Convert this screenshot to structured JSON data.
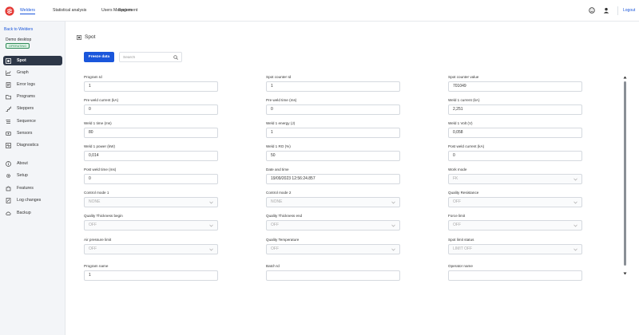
{
  "topbar": {
    "tabs": [
      {
        "label": "Welders",
        "active": true
      },
      {
        "label": "Statistical analysis",
        "active": false
      },
      {
        "label": "Users Management",
        "active": false
      },
      {
        "label": "System",
        "active": false
      }
    ],
    "logout_label": "Logout"
  },
  "sidebar": {
    "back_label": "Back to Welders",
    "device_name": "Demo desktop",
    "status_badge": "OPERATING",
    "items": [
      {
        "label": "Spot",
        "icon": "spot-icon",
        "active": true
      },
      {
        "label": "Graph",
        "icon": "graph-icon"
      },
      {
        "label": "Error logs",
        "icon": "error-logs-icon"
      },
      {
        "label": "Programs",
        "icon": "folder-icon"
      },
      {
        "label": "Steppers",
        "icon": "steppers-icon"
      },
      {
        "label": "Sequence",
        "icon": "sequence-icon"
      },
      {
        "label": "Sensors",
        "icon": "sensors-icon"
      },
      {
        "label": "Diagnostics",
        "icon": "diagnostics-icon"
      },
      {
        "label": "About",
        "icon": "info-icon"
      },
      {
        "label": "Setup",
        "icon": "gear-icon"
      },
      {
        "label": "Features",
        "icon": "puzzle-icon"
      },
      {
        "label": "Log changes",
        "icon": "log-changes-icon"
      },
      {
        "label": "Backup",
        "icon": "backup-icon"
      }
    ]
  },
  "main": {
    "title": "Spot",
    "create_label": "Freeze data",
    "search_placeholder": "Search",
    "fields": [
      {
        "label": "Program Id",
        "value": "1",
        "type": "input"
      },
      {
        "label": "Spot counter Id",
        "value": "1",
        "type": "input"
      },
      {
        "label": "Spot counter value",
        "value": "701049",
        "type": "input"
      },
      {
        "label": "Pre weld current (kA)",
        "value": "0",
        "type": "input"
      },
      {
        "label": "Pre weld time (ms)",
        "value": "0",
        "type": "input"
      },
      {
        "label": "Weld 1 current (kA)",
        "value": "2,251",
        "type": "input"
      },
      {
        "label": "Weld 1 time (ms)",
        "value": "80",
        "type": "input"
      },
      {
        "label": "Weld 1 energy (J)",
        "value": "1",
        "type": "input"
      },
      {
        "label": "Weld 1 Volt (V)",
        "value": "0,058",
        "type": "input"
      },
      {
        "label": "Weld 1 power (kW)",
        "value": "0,014",
        "type": "input"
      },
      {
        "label": "Weld 1 RO (%)",
        "value": "50",
        "type": "input"
      },
      {
        "label": "Post weld current (kA)",
        "value": "0",
        "type": "input"
      },
      {
        "label": "Post weld time (ms)",
        "value": "0",
        "type": "input"
      },
      {
        "label": "Date and time",
        "value": "19/09/2023 12:56:24.857",
        "type": "input"
      },
      {
        "label": "Work mode",
        "value": "FK",
        "type": "select"
      },
      {
        "label": "Control mode 1",
        "value": "NONE",
        "type": "select"
      },
      {
        "label": "Control mode 2",
        "value": "NONE",
        "type": "select"
      },
      {
        "label": "Quality Resistance",
        "value": "OFF",
        "type": "select"
      },
      {
        "label": "Quality Thickness begin",
        "value": "OFF",
        "type": "select"
      },
      {
        "label": "Quality Thickness end",
        "value": "OFF",
        "type": "select"
      },
      {
        "label": "Force limit",
        "value": "OFF",
        "type": "select"
      },
      {
        "label": "Air pressure limit",
        "value": "OFF",
        "type": "select"
      },
      {
        "label": "Quality Temperature",
        "value": "OFF",
        "type": "select"
      },
      {
        "label": "Spot limit status",
        "value": "LIMIT OFF",
        "type": "select"
      },
      {
        "label": "Program name",
        "value": "1",
        "type": "input"
      },
      {
        "label": "Batch Id",
        "value": "",
        "type": "input"
      },
      {
        "label": "Operator name",
        "value": "",
        "type": "input"
      }
    ]
  },
  "colors": {
    "accent": "#1a56db",
    "sidebar_active": "#2d3748",
    "badge_green": "#2e8b57"
  }
}
